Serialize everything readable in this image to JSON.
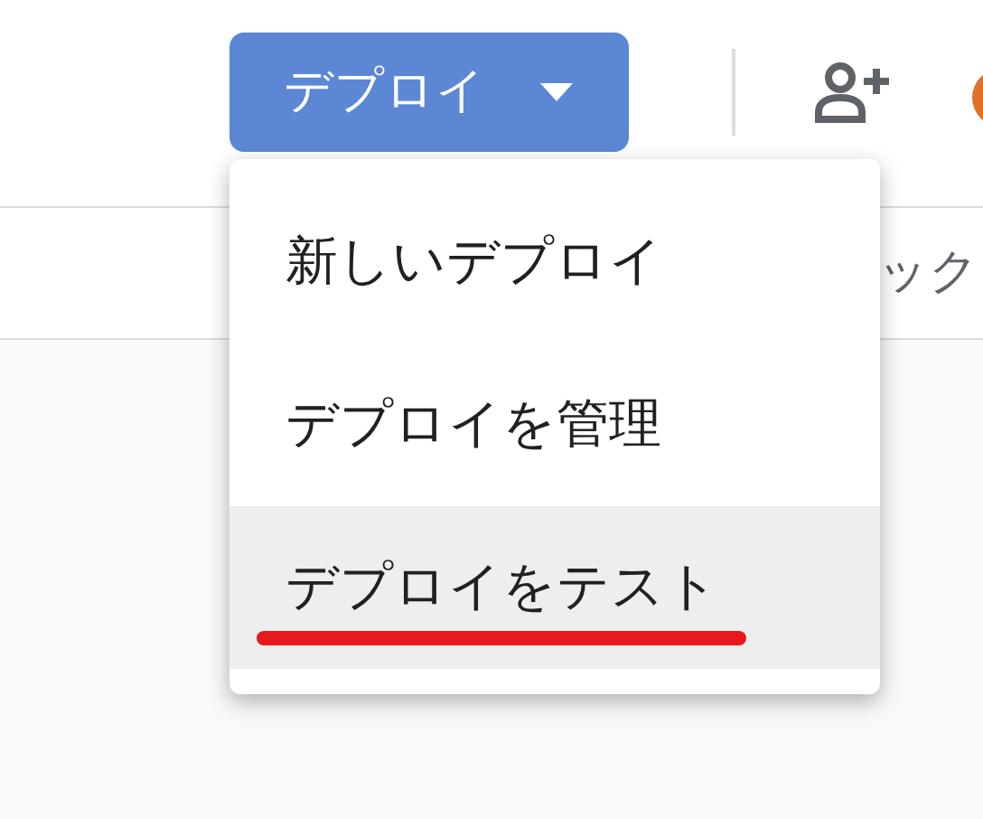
{
  "header": {
    "deploy_button": {
      "label": "デプロイ",
      "expanded": true
    },
    "avatar": {
      "color": "#e0702a"
    }
  },
  "toolbar": {
    "text": "ック"
  },
  "deploy_menu": [
    {
      "label": "新しいデプロイ",
      "selected": false,
      "underlined": false
    },
    {
      "label": "デプロイを管理",
      "selected": false,
      "underlined": false
    },
    {
      "label": "デプロイをテスト",
      "selected": true,
      "underlined": true
    }
  ]
}
